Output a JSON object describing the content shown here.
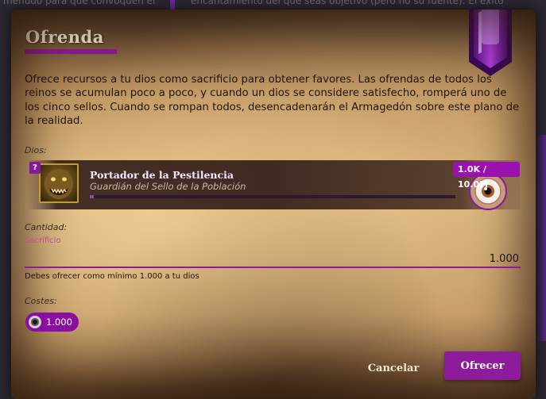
{
  "background": {
    "left_text": "menudo para que convoquen el",
    "right_text": "encantamiento del que seas objetivo (pero no su fuente). El éxito"
  },
  "modal": {
    "title": "Ofrenda",
    "description": "Ofrece recursos a tu dios como sacrificio para obtener favores. Las ofrendas de todos los reinos se acumulan poco a poco, y cuando un dios se considere satisfecho, romperá uno de los cinco sellos. Cuando se rompan todos, desencadenarán el Armagedón sobre este plano de la realidad."
  },
  "gods": {
    "label": "Dios:",
    "selected": {
      "name": "Portador de la Pestilencia",
      "subtitle": "Guardián del Sello de la Población",
      "badge": "?",
      "progress_label": "1.0K / 10.0M",
      "progress_fraction": 0.0001
    }
  },
  "quantity": {
    "label": "Cantidad:",
    "hint": "Sacrificio",
    "value": "1.000",
    "help": "Debes ofrecer como mínimo 1.000 a tu dios"
  },
  "costs": {
    "label": "Costes:",
    "items": [
      {
        "icon": "eye-icon",
        "value": "1.000"
      }
    ]
  },
  "buttons": {
    "cancel": "Cancelar",
    "offer": "Ofrecer"
  },
  "colors": {
    "accent": "#8e1a9c",
    "badge": "#9a10b0"
  }
}
